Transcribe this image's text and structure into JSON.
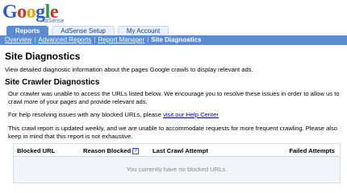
{
  "logo": {
    "name": "Google",
    "sub": "AdSense"
  },
  "tabs": [
    {
      "label": "Reports"
    },
    {
      "label": "AdSense Setup"
    },
    {
      "label": "My Account"
    }
  ],
  "subnav": {
    "items": [
      "Overview",
      "Advanced Reports",
      "Report Manager"
    ],
    "current": "Site Diagnostics",
    "separator": "|"
  },
  "page": {
    "title": "Site Diagnostics",
    "description": "View detailed diagnostic information about the pages Google crawls to display relevant ads.",
    "section_title": "Site Crawler Diagnostics",
    "para1": "Our crawler was unable to access the URLs listed below. We encourage you to resolve these issues in order to allow us to crawl more of your pages and provide relevant ads.",
    "para2_prefix": "For help resolving issues with any blocked URLs, please",
    "para2_link": "visit our Help Center",
    "para3": "This crawl report is updated weekly, and we are unable to accommodate requests for more frequent crawling. Please also keep in mind that this report is not exhaustive."
  },
  "table": {
    "columns": [
      "Blocked URL",
      "Reason Blocked",
      "Last Crawl Attempt",
      "Failed Attempts"
    ],
    "help_glyph": "?",
    "empty_message": "You currently have no blocked URLs."
  },
  "colors": {
    "accent": "#5b8bd0",
    "link": "#0000cc"
  }
}
